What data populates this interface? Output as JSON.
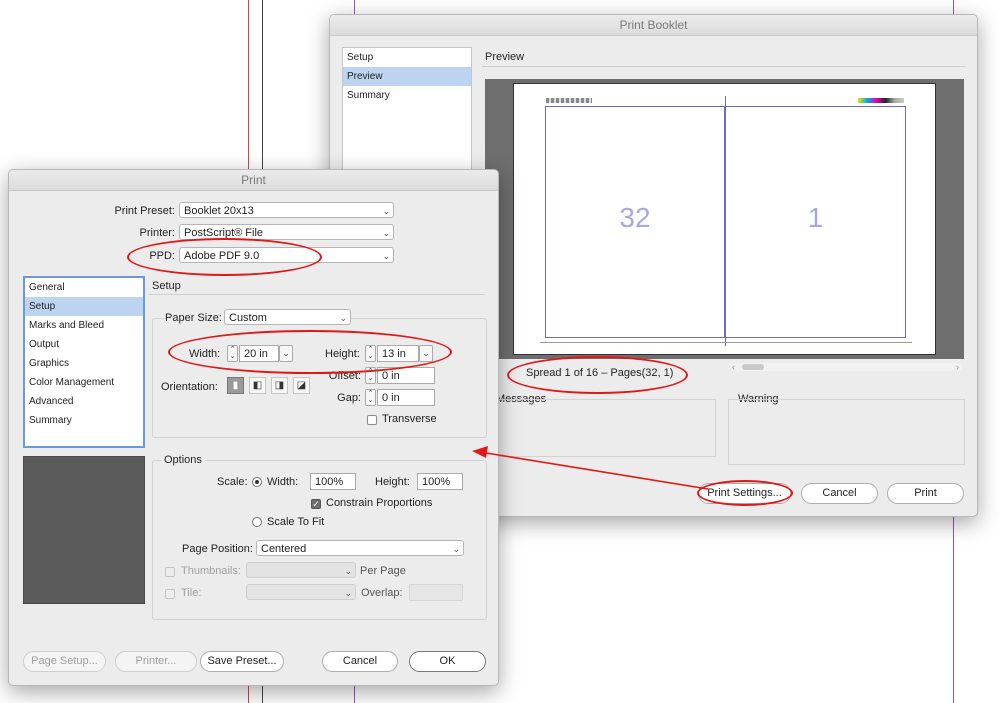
{
  "background": {
    "guide_red": "#e04040",
    "guide_purple": "#9b4fd6"
  },
  "booklet": {
    "title": "Print Booklet",
    "nav": [
      "Setup",
      "Preview",
      "Summary"
    ],
    "nav_selected": 1,
    "preview_heading": "Preview",
    "spread_numbers": [
      "32",
      "1"
    ],
    "spread_label": "Spread 1 of 16 – Pages(32, 1)",
    "messages_label": "Messages",
    "warning_label": "Warning",
    "buttons": {
      "print_settings": "Print Settings...",
      "cancel": "Cancel",
      "print": "Print"
    }
  },
  "print": {
    "title": "Print",
    "preset_label": "Print Preset:",
    "preset_value": "Booklet 20x13",
    "printer_label": "Printer:",
    "printer_value": "PostScript® File",
    "ppd_label": "PPD:",
    "ppd_value": "Adobe PDF 9.0",
    "nav": [
      "General",
      "Setup",
      "Marks and Bleed",
      "Output",
      "Graphics",
      "Color Management",
      "Advanced",
      "Summary"
    ],
    "nav_selected": 1,
    "setup_heading": "Setup",
    "paper_size_label": "Paper Size:",
    "paper_size_value": "Custom",
    "width_label": "Width:",
    "width_value": "20 in",
    "height_label": "Height:",
    "height_value": "13 in",
    "orientation_label": "Orientation:",
    "offset_label": "Offset:",
    "offset_value": "0 in",
    "gap_label": "Gap:",
    "gap_value": "0 in",
    "transverse_label": "Transverse",
    "options_heading": "Options",
    "scale_label": "Scale:",
    "scale_width_label": "Width:",
    "scale_width_value": "100%",
    "scale_height_label": "Height:",
    "scale_height_value": "100%",
    "constrain_label": "Constrain Proportions",
    "scale_to_fit_label": "Scale To Fit",
    "page_position_label": "Page Position:",
    "page_position_value": "Centered",
    "thumbnails_label": "Thumbnails:",
    "per_page_label": "Per Page",
    "tile_label": "Tile:",
    "overlap_label": "Overlap:",
    "buttons": {
      "page_setup": "Page Setup...",
      "printer": "Printer...",
      "save_preset": "Save Preset...",
      "cancel": "Cancel",
      "ok": "OK"
    }
  },
  "annotation_color": "#e01818"
}
